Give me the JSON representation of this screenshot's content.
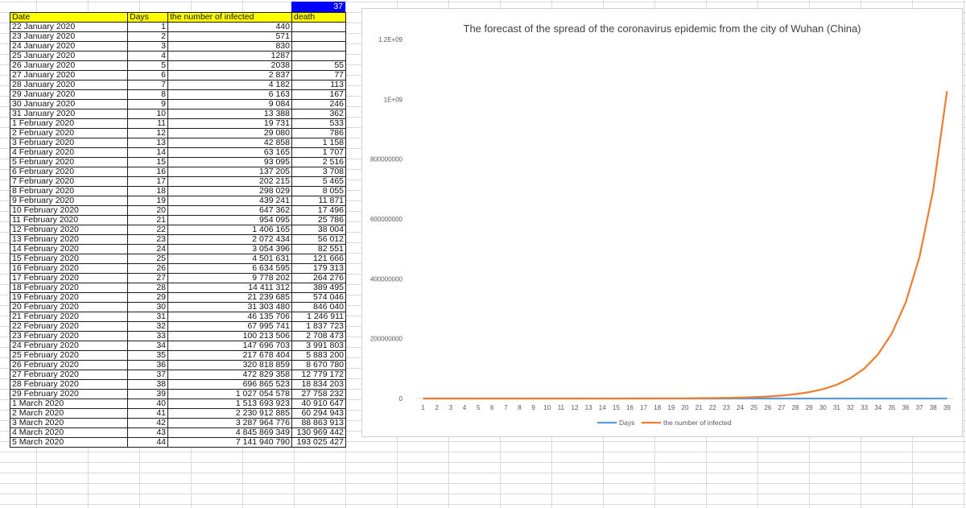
{
  "sheet": {
    "selected_cell_value": "37",
    "headers": [
      "Date",
      "Days",
      "the number of infected",
      "death"
    ],
    "rows": [
      [
        "22 January 2020",
        "1",
        "440",
        ""
      ],
      [
        "23 January 2020",
        "2",
        "571",
        ""
      ],
      [
        "24 January 2020",
        "3",
        "830",
        ""
      ],
      [
        "25 January 2020",
        "4",
        "1287",
        ""
      ],
      [
        "26 January 2020",
        "5",
        "2038",
        "55"
      ],
      [
        "27 January 2020",
        "6",
        "2 837",
        "77"
      ],
      [
        "28 January 2020",
        "7",
        "4 182",
        "113"
      ],
      [
        "29 January 2020",
        "8",
        "6 163",
        "167"
      ],
      [
        "30 January 2020",
        "9",
        "9 084",
        "246"
      ],
      [
        "31 January 2020",
        "10",
        "13 388",
        "362"
      ],
      [
        "1 February 2020",
        "11",
        "19 731",
        "533"
      ],
      [
        "2 February 2020",
        "12",
        "29 080",
        "786"
      ],
      [
        "3 February 2020",
        "13",
        "42 858",
        "1 158"
      ],
      [
        "4 February 2020",
        "14",
        "63 165",
        "1 707"
      ],
      [
        "5 February 2020",
        "15",
        "93 095",
        "2 516"
      ],
      [
        "6 February 2020",
        "16",
        "137 205",
        "3 708"
      ],
      [
        "7 February 2020",
        "17",
        "202 215",
        "5 465"
      ],
      [
        "8 February 2020",
        "18",
        "298 029",
        "8 055"
      ],
      [
        "9 February 2020",
        "19",
        "439 241",
        "11 871"
      ],
      [
        "10 February 2020",
        "20",
        "647 362",
        "17 496"
      ],
      [
        "11 February 2020",
        "21",
        "954 095",
        "25 786"
      ],
      [
        "12 February 2020",
        "22",
        "1 406 165",
        "38 004"
      ],
      [
        "13 February 2020",
        "23",
        "2 072 434",
        "56 012"
      ],
      [
        "14 February 2020",
        "24",
        "3 054 396",
        "82 551"
      ],
      [
        "15 February 2020",
        "25",
        "4 501 631",
        "121 666"
      ],
      [
        "16 February 2020",
        "26",
        "6 634 595",
        "179 313"
      ],
      [
        "17 February 2020",
        "27",
        "9 778 202",
        "264 276"
      ],
      [
        "18 February 2020",
        "28",
        "14 411 312",
        "389 495"
      ],
      [
        "19 February 2020",
        "29",
        "21 239 685",
        "574 046"
      ],
      [
        "20 February 2020",
        "30",
        "31 303 480",
        "846 040"
      ],
      [
        "21 February 2020",
        "31",
        "46 135 706",
        "1 246 911"
      ],
      [
        "22 February 2020",
        "32",
        "67 995 741",
        "1 837 723"
      ],
      [
        "23 February 2020",
        "33",
        "100 213 506",
        "2 708 473"
      ],
      [
        "24 February 2020",
        "34",
        "147 696 703",
        "3 991 803"
      ],
      [
        "25 February 2020",
        "35",
        "217 678 404",
        "5 883 200"
      ],
      [
        "26 February 2020",
        "36",
        "320 818 859",
        "8 670 780"
      ],
      [
        "27 February 2020",
        "37",
        "472 829 358",
        "12 779 172"
      ],
      [
        "28 February 2020",
        "38",
        "696 865 523",
        "18 834 203"
      ],
      [
        "29 February 2020",
        "39",
        "1 027 054 578",
        "27 758 232"
      ],
      [
        "1 March 2020",
        "40",
        "1 513 693 923",
        "40 910 647"
      ],
      [
        "2 March 2020",
        "41",
        "2 230 912 885",
        "60 294 943"
      ],
      [
        "3 March 2020",
        "42",
        "3 287 964 776",
        "88 863 913"
      ],
      [
        "4 March 2020",
        "43",
        "4 845 869 349",
        "130 969 442"
      ],
      [
        "5 March 2020",
        "44",
        "7 141 940 790",
        "193 025 427"
      ]
    ]
  },
  "colors": {
    "header_fill": "#ffff00",
    "selected_cell": "#0000ff",
    "days_series": "#5b9bd5",
    "infected_series": "#ed7d31"
  },
  "chart_data": {
    "type": "line",
    "title": "The forecast of the spread of the coronavirus epidemic from the city of Wuhan (China)",
    "x": [
      1,
      2,
      3,
      4,
      5,
      6,
      7,
      8,
      9,
      10,
      11,
      12,
      13,
      14,
      15,
      16,
      17,
      18,
      19,
      20,
      21,
      22,
      23,
      24,
      25,
      26,
      27,
      28,
      29,
      30,
      31,
      32,
      33,
      34,
      35,
      36,
      37,
      38,
      39
    ],
    "x_tick_labels": [
      "1",
      "2",
      "3",
      "4",
      "5",
      "6",
      "7",
      "8",
      "9",
      "10",
      "11",
      "12",
      "13",
      "14",
      "15",
      "16",
      "17",
      "18",
      "19",
      "20",
      "21",
      "22",
      "23",
      "24",
      "25",
      "26",
      "27",
      "28",
      "29",
      "30",
      "31",
      "32",
      "33",
      "34",
      "35",
      "36",
      "37",
      "38",
      "39"
    ],
    "y_tick_values": [
      0,
      200000000,
      400000000,
      600000000,
      800000000,
      1000000000,
      1200000000
    ],
    "y_tick_labels": [
      "0",
      "200000000",
      "400000000",
      "600000000",
      "800000000",
      "1E+09",
      "1.2E+09"
    ],
    "ylim": [
      0,
      1200000000
    ],
    "grid": false,
    "legend_position": "bottom",
    "series": [
      {
        "name": "Days",
        "values": [
          1,
          2,
          3,
          4,
          5,
          6,
          7,
          8,
          9,
          10,
          11,
          12,
          13,
          14,
          15,
          16,
          17,
          18,
          19,
          20,
          21,
          22,
          23,
          24,
          25,
          26,
          27,
          28,
          29,
          30,
          31,
          32,
          33,
          34,
          35,
          36,
          37,
          38,
          39
        ]
      },
      {
        "name": "the number of infected",
        "values": [
          440,
          571,
          830,
          1287,
          2038,
          2837,
          4182,
          6163,
          9084,
          13388,
          19731,
          29080,
          42858,
          63165,
          93095,
          137205,
          202215,
          298029,
          439241,
          647362,
          954095,
          1406165,
          2072434,
          3054396,
          4501631,
          6634595,
          9778202,
          14411312,
          21239685,
          31303480,
          46135706,
          67995741,
          100213506,
          147696703,
          217678404,
          320818859,
          472829358,
          696865523,
          1027054578
        ]
      }
    ]
  }
}
